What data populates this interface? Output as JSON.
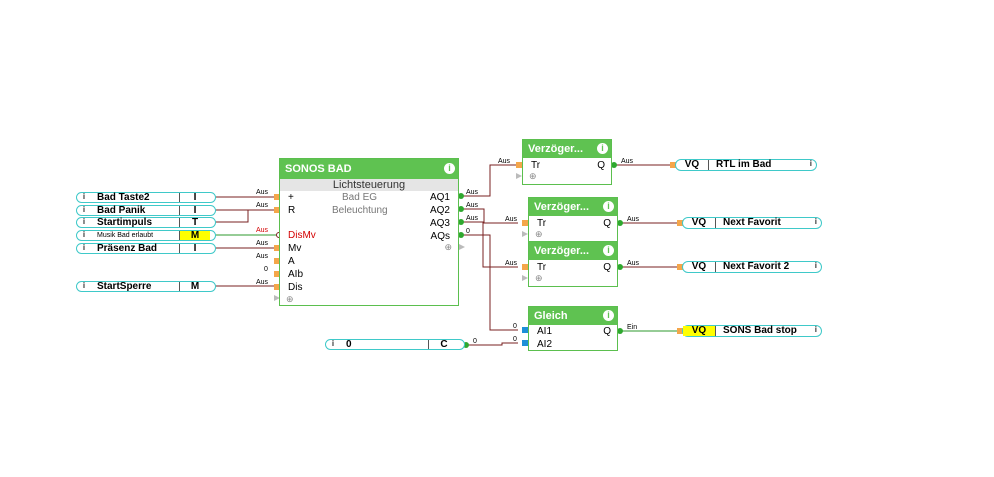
{
  "inputs": [
    {
      "label": "Bad Taste2",
      "type": "I",
      "info": "i"
    },
    {
      "label": "Bad Panik",
      "type": "I",
      "info": "i"
    },
    {
      "label": "Startimpuls",
      "type": "T",
      "info": "i"
    },
    {
      "label": "Musik Bad erlaubt",
      "type": "M",
      "info": "i"
    },
    {
      "label": "Präsenz Bad",
      "type": "I",
      "info": "i"
    },
    {
      "label": "StartSperre",
      "type": "M",
      "info": "i"
    }
  ],
  "constant": {
    "value": "0",
    "type": "C",
    "info": "i"
  },
  "sonos": {
    "title": "SONOS BAD",
    "subtitle": "Lichtsteuerung",
    "line2": "Bad EG",
    "line3": "Beleuchtung",
    "inputs": [
      "+",
      "R",
      "DisMv",
      "Mv",
      "A",
      "AIb",
      "Dis"
    ],
    "outputs": [
      "AQ1",
      "AQ2",
      "AQ3",
      "AQs"
    ]
  },
  "delays": [
    {
      "title": "Verzöger...",
      "in": "Tr",
      "out": "Q"
    },
    {
      "title": "Verzöger...",
      "in": "Tr",
      "out": "Q"
    },
    {
      "title": "Verzöger...",
      "in": "Tr",
      "out": "Q"
    }
  ],
  "gleich": {
    "title": "Gleich",
    "inputs": [
      "AI1",
      "AI2"
    ],
    "out": "Q"
  },
  "outputs": [
    {
      "type": "VQ",
      "label": "RTL im Bad",
      "info": "i"
    },
    {
      "type": "VQ",
      "label": "Next Favorit",
      "info": "i"
    },
    {
      "type": "VQ",
      "label": "Next Favorit 2",
      "info": "i"
    },
    {
      "type": "VQ",
      "label": "SONS Bad stop",
      "info": "i"
    }
  ],
  "wire_labels": {
    "aus": "Aus",
    "ein": "Ein",
    "zero": "0"
  },
  "colors": {
    "block_green": "#5fc251",
    "input_border": "#3fc9c9",
    "marker_yellow": "#ffff00",
    "wire": "#7a2020",
    "wire_green": "#2e9a2e",
    "alert_text": "#d40000"
  }
}
